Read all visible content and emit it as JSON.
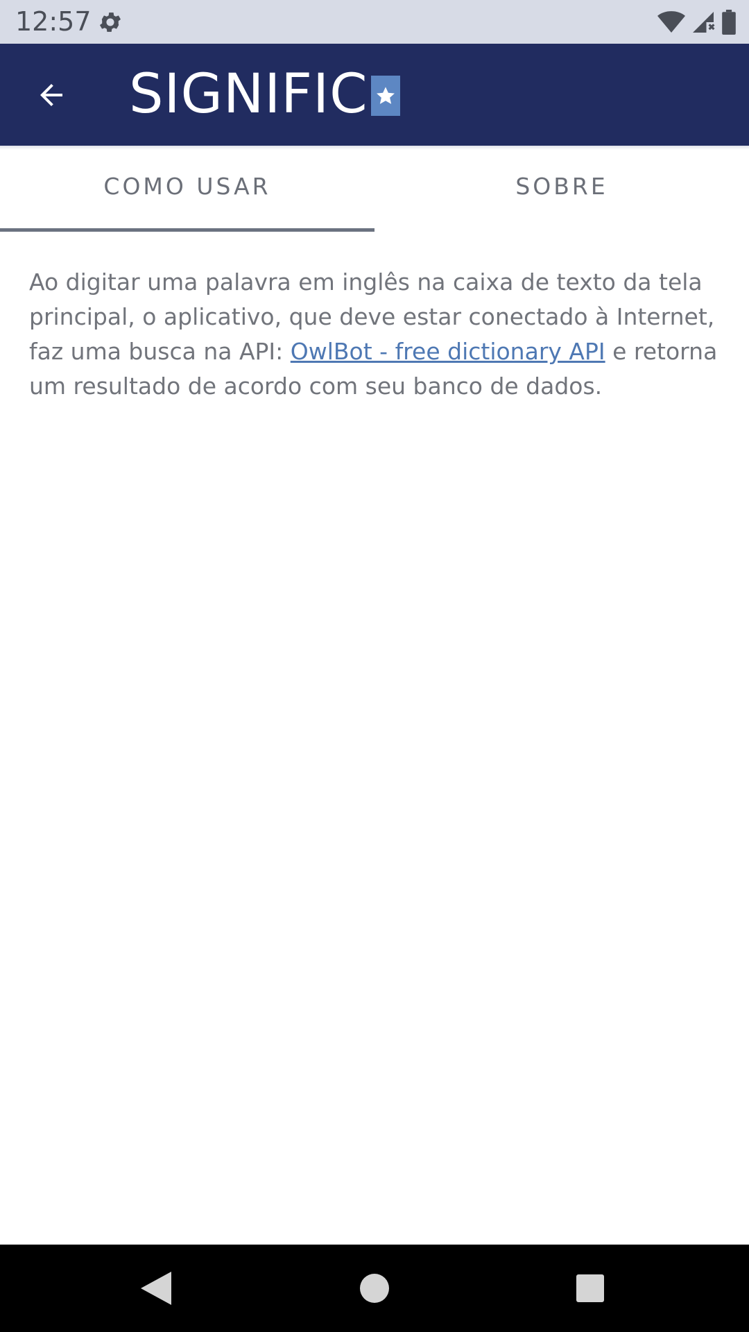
{
  "status_bar": {
    "time": "12:57",
    "icons": [
      "gear-icon",
      "wifi-icon",
      "signal-icon",
      "battery-icon"
    ]
  },
  "app_bar": {
    "title": "SIGNIFIC",
    "back_icon": "arrow-back-icon",
    "logo_mark": "star-icon"
  },
  "tabs": [
    {
      "label": "COMO USAR",
      "selected": true
    },
    {
      "label": "SOBRE",
      "selected": false
    }
  ],
  "content": {
    "text_before_link": "Ao digitar uma palavra em inglês na caixa de texto da tela principal, o aplicativo, que deve estar conectado à Internet, faz uma busca na API: ",
    "link_text": "OwlBot - free dictionary API",
    "text_after_link": " e retorna um resultado de acordo com seu banco de dados."
  },
  "nav_bar": {
    "icons": [
      "back-triangle-icon",
      "home-circle-icon",
      "recents-square-icon"
    ]
  },
  "colors": {
    "app_bar": "#212c60",
    "status_bar": "#d7dbe6",
    "logo_accent": "#5d87c3",
    "link": "#4e78b3",
    "body_text": "#71747b"
  }
}
